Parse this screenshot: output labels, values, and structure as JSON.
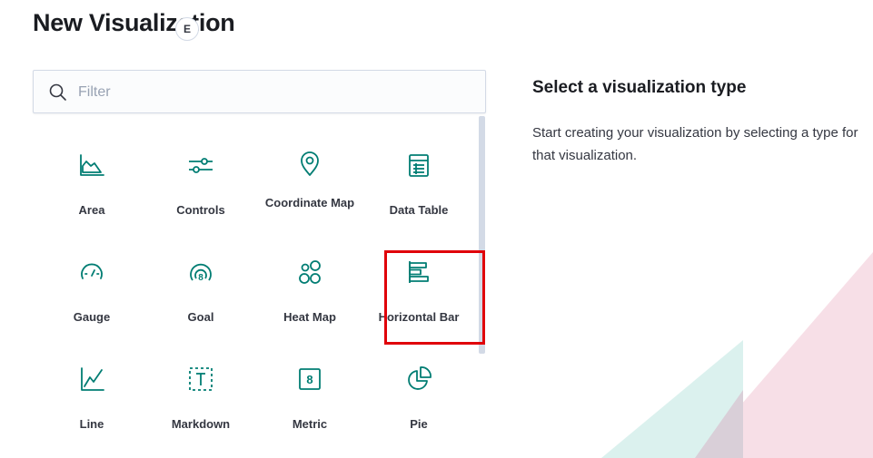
{
  "page_title": "New Visualization",
  "search": {
    "placeholder": "Filter",
    "value": ""
  },
  "side_panel": {
    "title": "Select a visualization type",
    "description": "Start creating your visualization by selecting a type for that visualization."
  },
  "colors": {
    "accent": "#017d73",
    "highlight": "#e0000a",
    "text": "#343741"
  },
  "types": [
    {
      "label": "Area",
      "icon": "area-chart-icon"
    },
    {
      "label": "Controls",
      "icon": "controls-icon",
      "badge": "E"
    },
    {
      "label": "Coordinate Map",
      "icon": "map-pin-icon"
    },
    {
      "label": "Data Table",
      "icon": "table-icon"
    },
    {
      "label": "Gauge",
      "icon": "gauge-icon"
    },
    {
      "label": "Goal",
      "icon": "goal-icon"
    },
    {
      "label": "Heat Map",
      "icon": "heatmap-icon"
    },
    {
      "label": "Horizontal Bar",
      "icon": "horizontal-bar-icon"
    },
    {
      "label": "Line",
      "icon": "line-chart-icon"
    },
    {
      "label": "Markdown",
      "icon": "markdown-icon"
    },
    {
      "label": "Metric",
      "icon": "metric-icon",
      "glyph": "8"
    },
    {
      "label": "Pie",
      "icon": "pie-chart-icon"
    }
  ]
}
